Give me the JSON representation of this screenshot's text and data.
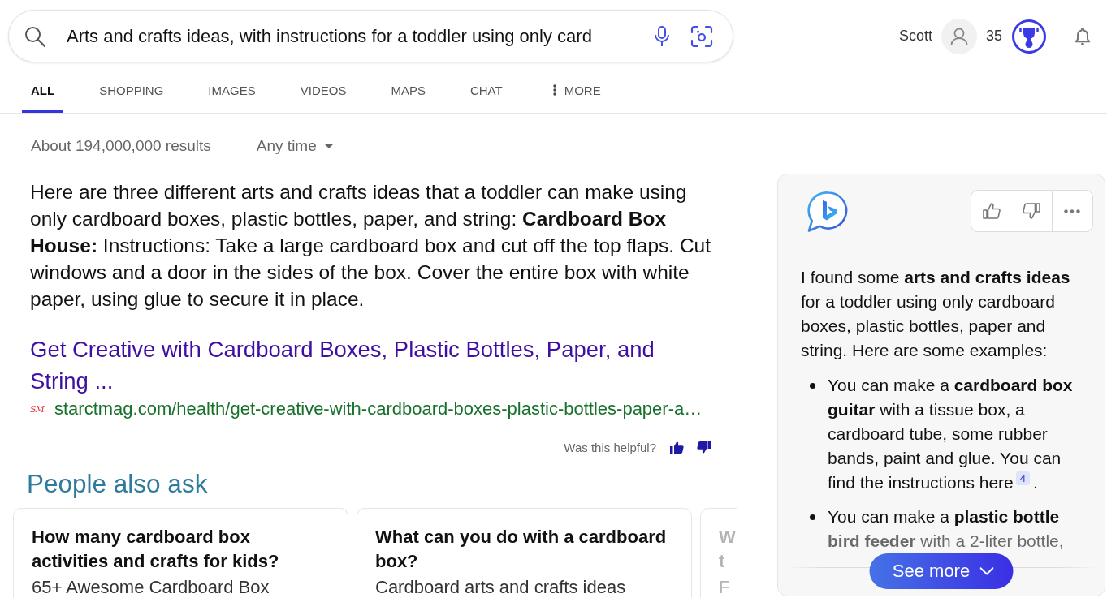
{
  "search": {
    "query": "Arts and crafts ideas, with instructions for a toddler using only card"
  },
  "account": {
    "name": "Scott",
    "points": "35"
  },
  "tabs": [
    {
      "label": "ALL",
      "selected": true,
      "kind": "link"
    },
    {
      "label": "SHOPPING",
      "selected": false,
      "kind": "link"
    },
    {
      "label": "IMAGES",
      "selected": false,
      "kind": "link"
    },
    {
      "label": "VIDEOS",
      "selected": false,
      "kind": "link"
    },
    {
      "label": "MAPS",
      "selected": false,
      "kind": "link"
    },
    {
      "label": "CHAT",
      "selected": false,
      "kind": "link"
    },
    {
      "label": "MORE",
      "selected": false,
      "kind": "menu"
    }
  ],
  "results": {
    "count": "About 194,000,000 results",
    "time_filter": "Any time"
  },
  "answer": {
    "text": "Here are three different arts and crafts ideas that a toddler can make using only cardboard boxes, plastic bottles, paper, and string: **Cardboard Box House:** Instructions: Take a large cardboard box and cut off the top flaps. Cut windows and a door in the sides of the box. Cover the entire box with white paper, using glue to secure it in place.",
    "source": {
      "title": "Get Creative with Cardboard Boxes, Plastic Bottles, Paper, and String ...",
      "favicon": "SM.",
      "url": "starctmag.com/health/get-creative-with-cardboard-boxes-plastic-bottles-paper-a…"
    },
    "feedback_prompt": "Was this helpful?"
  },
  "people_also_ask": {
    "title": "People also ask",
    "questions": [
      {
        "question": "How many cardboard box activities and crafts for kids?",
        "snippet": "65+ Awesome Cardboard Box",
        "faded": false
      },
      {
        "question": "What can you do with a cardboard box?",
        "snippet": "Cardboard arts and crafts ideas",
        "faded": false
      },
      {
        "question": "W t",
        "snippet": "F",
        "faded": true
      }
    ]
  },
  "chat": {
    "intro": "I found some **arts and crafts ideas** for a toddler using only cardboard boxes, plastic bottles, paper and string. Here are some examples:",
    "bullets": [
      {
        "text": "You can make a **cardboard box guitar** with a tissue box, a cardboard tube, some rubber bands, paint and glue. You can find the instructions here",
        "citation": "4",
        "after": "."
      },
      {
        "text": "You can make a **plastic bottle bird feeder** with a 2-liter bottle,"
      }
    ],
    "see_more": "See more"
  }
}
